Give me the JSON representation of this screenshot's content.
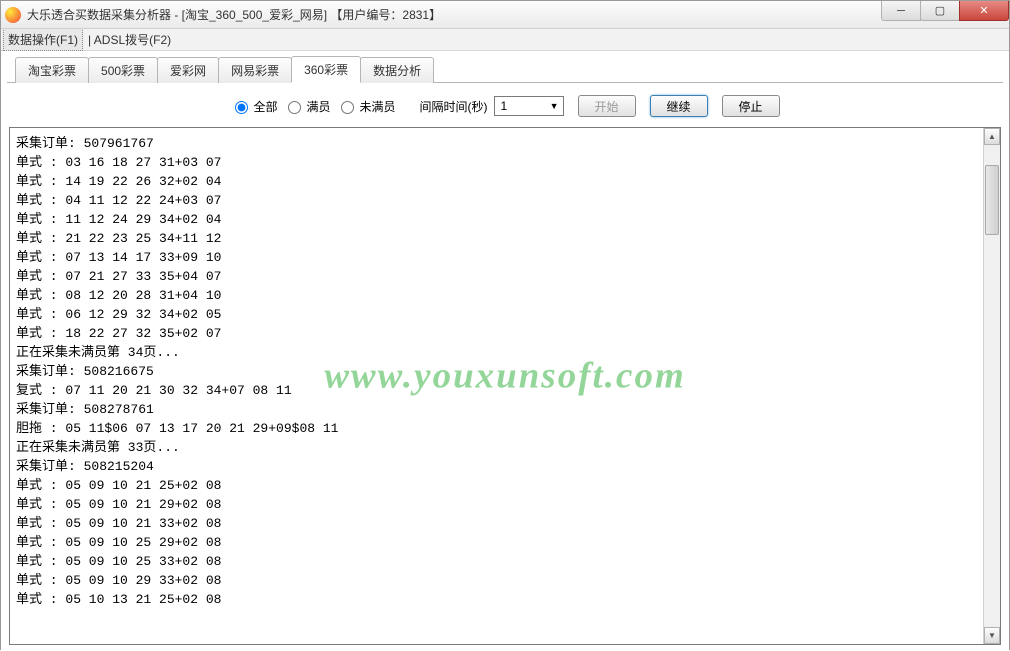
{
  "window": {
    "title": "大乐透合买数据采集分析器 - [淘宝_360_500_爱彩_网易]      【用户编号：2831】"
  },
  "menu": {
    "dataOps": "数据操作(F1)",
    "adsl": "| ADSL拨号(F2)"
  },
  "tabs": [
    {
      "label": "淘宝彩票"
    },
    {
      "label": "500彩票"
    },
    {
      "label": "爱彩网"
    },
    {
      "label": "网易彩票"
    },
    {
      "label": "360彩票"
    },
    {
      "label": "数据分析"
    }
  ],
  "activeTab": 4,
  "controls": {
    "radioAll": "全部",
    "radioFull": "满员",
    "radioNotFull": "未满员",
    "intervalLabel": "间隔时间(秒)",
    "intervalValue": "1",
    "startBtn": "开始",
    "continueBtn": "继续",
    "stopBtn": "停止"
  },
  "watermark": "www.youxunsoft.com",
  "logLines": [
    "采集订单: 507961767",
    "单式 : 03 16 18 27 31+03 07",
    "单式 : 14 19 22 26 32+02 04",
    "单式 : 04 11 12 22 24+03 07",
    "单式 : 11 12 24 29 34+02 04",
    "单式 : 21 22 23 25 34+11 12",
    "单式 : 07 13 14 17 33+09 10",
    "单式 : 07 21 27 33 35+04 07",
    "单式 : 08 12 20 28 31+04 10",
    "单式 : 06 12 29 32 34+02 05",
    "单式 : 18 22 27 32 35+02 07",
    "正在采集未满员第 34页...",
    "采集订单: 508216675",
    "复式 : 07 11 20 21 30 32 34+07 08 11",
    "采集订单: 508278761",
    "胆拖 : 05 11$06 07 13 17 20 21 29+09$08 11",
    "正在采集未满员第 33页...",
    "采集订单: 508215204",
    "单式 : 05 09 10 21 25+02 08",
    "单式 : 05 09 10 21 29+02 08",
    "单式 : 05 09 10 21 33+02 08",
    "单式 : 05 09 10 25 29+02 08",
    "单式 : 05 09 10 25 33+02 08",
    "单式 : 05 09 10 29 33+02 08",
    "单式 : 05 10 13 21 25+02 08"
  ]
}
